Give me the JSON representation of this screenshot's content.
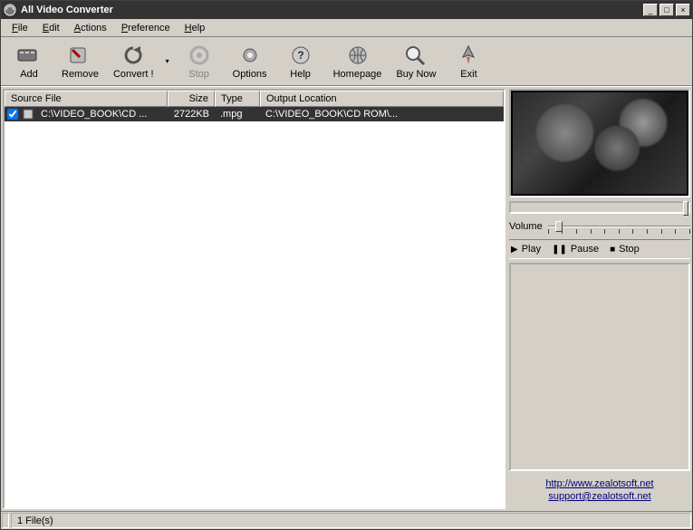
{
  "title": "All Video Converter",
  "menu": {
    "file": "File",
    "edit": "Edit",
    "actions": "Actions",
    "preference": "Preference",
    "help": "Help"
  },
  "toolbar": {
    "add": "Add",
    "remove": "Remove",
    "convert": "Convert !",
    "stop": "Stop",
    "options": "Options",
    "help": "Help",
    "homepage": "Homepage",
    "buynow": "Buy Now",
    "exit": "Exit"
  },
  "columns": {
    "source": "Source File",
    "size": "Size",
    "type": "Type",
    "output": "Output Location"
  },
  "files": [
    {
      "checked": true,
      "source": "C:\\VIDEO_BOOK\\CD ...",
      "size": "2722KB",
      "type": ".mpg",
      "output": "C:\\VIDEO_BOOK\\CD ROM\\..."
    }
  ],
  "side": {
    "volume_label": "Volume",
    "play": "Play",
    "pause": "Pause",
    "stop": "Stop",
    "link_site": "http://www.zealotsoft.net",
    "link_email": "support@zealotsoft.net"
  },
  "status": {
    "filecount": "1 File(s)"
  }
}
